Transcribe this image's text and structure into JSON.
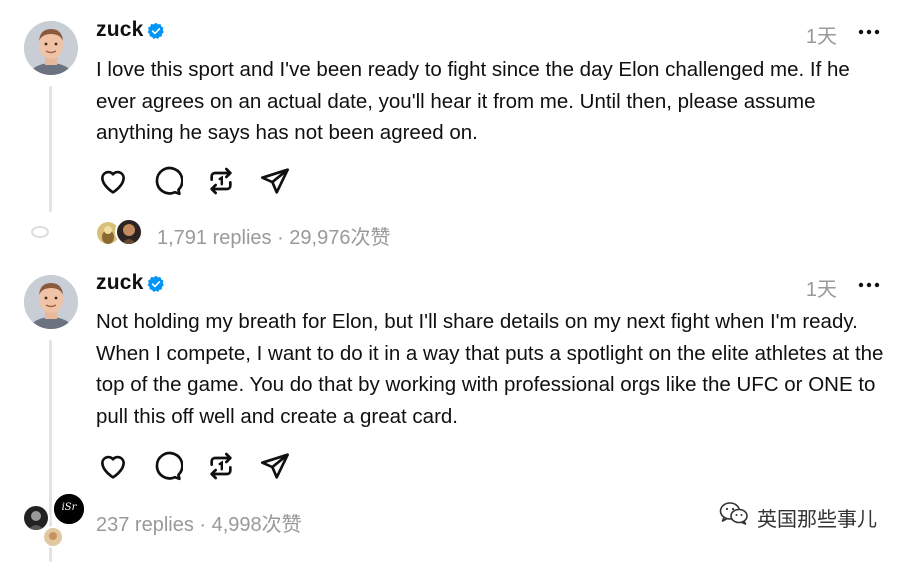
{
  "posts": [
    {
      "username": "zuck",
      "timestamp": "1天",
      "text": "I love this sport and I've been ready to fight since the day Elon challenged me. If he ever agrees on an actual date, you'll hear it from me. Until then, please assume anything he says has not been agreed on.",
      "stats": "1,791 replies · 29,976次赞"
    },
    {
      "username": "zuck",
      "timestamp": "1天",
      "text": "Not holding my breath for Elon, but I'll share details on my next fight when I'm ready. When I compete, I want to do it in a way that puts a spotlight on the elite athletes at the top of the game. You do that by working with professional orgs like the UFC or ONE to pull this off well and create a great card.",
      "stats": "237 replies · 4,998次赞"
    }
  ],
  "mini_avatar_labels": {
    "isr": "iSr"
  },
  "watermark": {
    "text": "英国那些事儿"
  },
  "icons": {
    "verified": "verified-badge-icon",
    "more": "more-options-icon",
    "like": "heart-icon",
    "reply": "comment-bubble-icon",
    "repost": "repost-icon",
    "share": "send-icon"
  },
  "colors": {
    "verified": "#0095f6",
    "muted": "#999999",
    "text": "#101010"
  }
}
